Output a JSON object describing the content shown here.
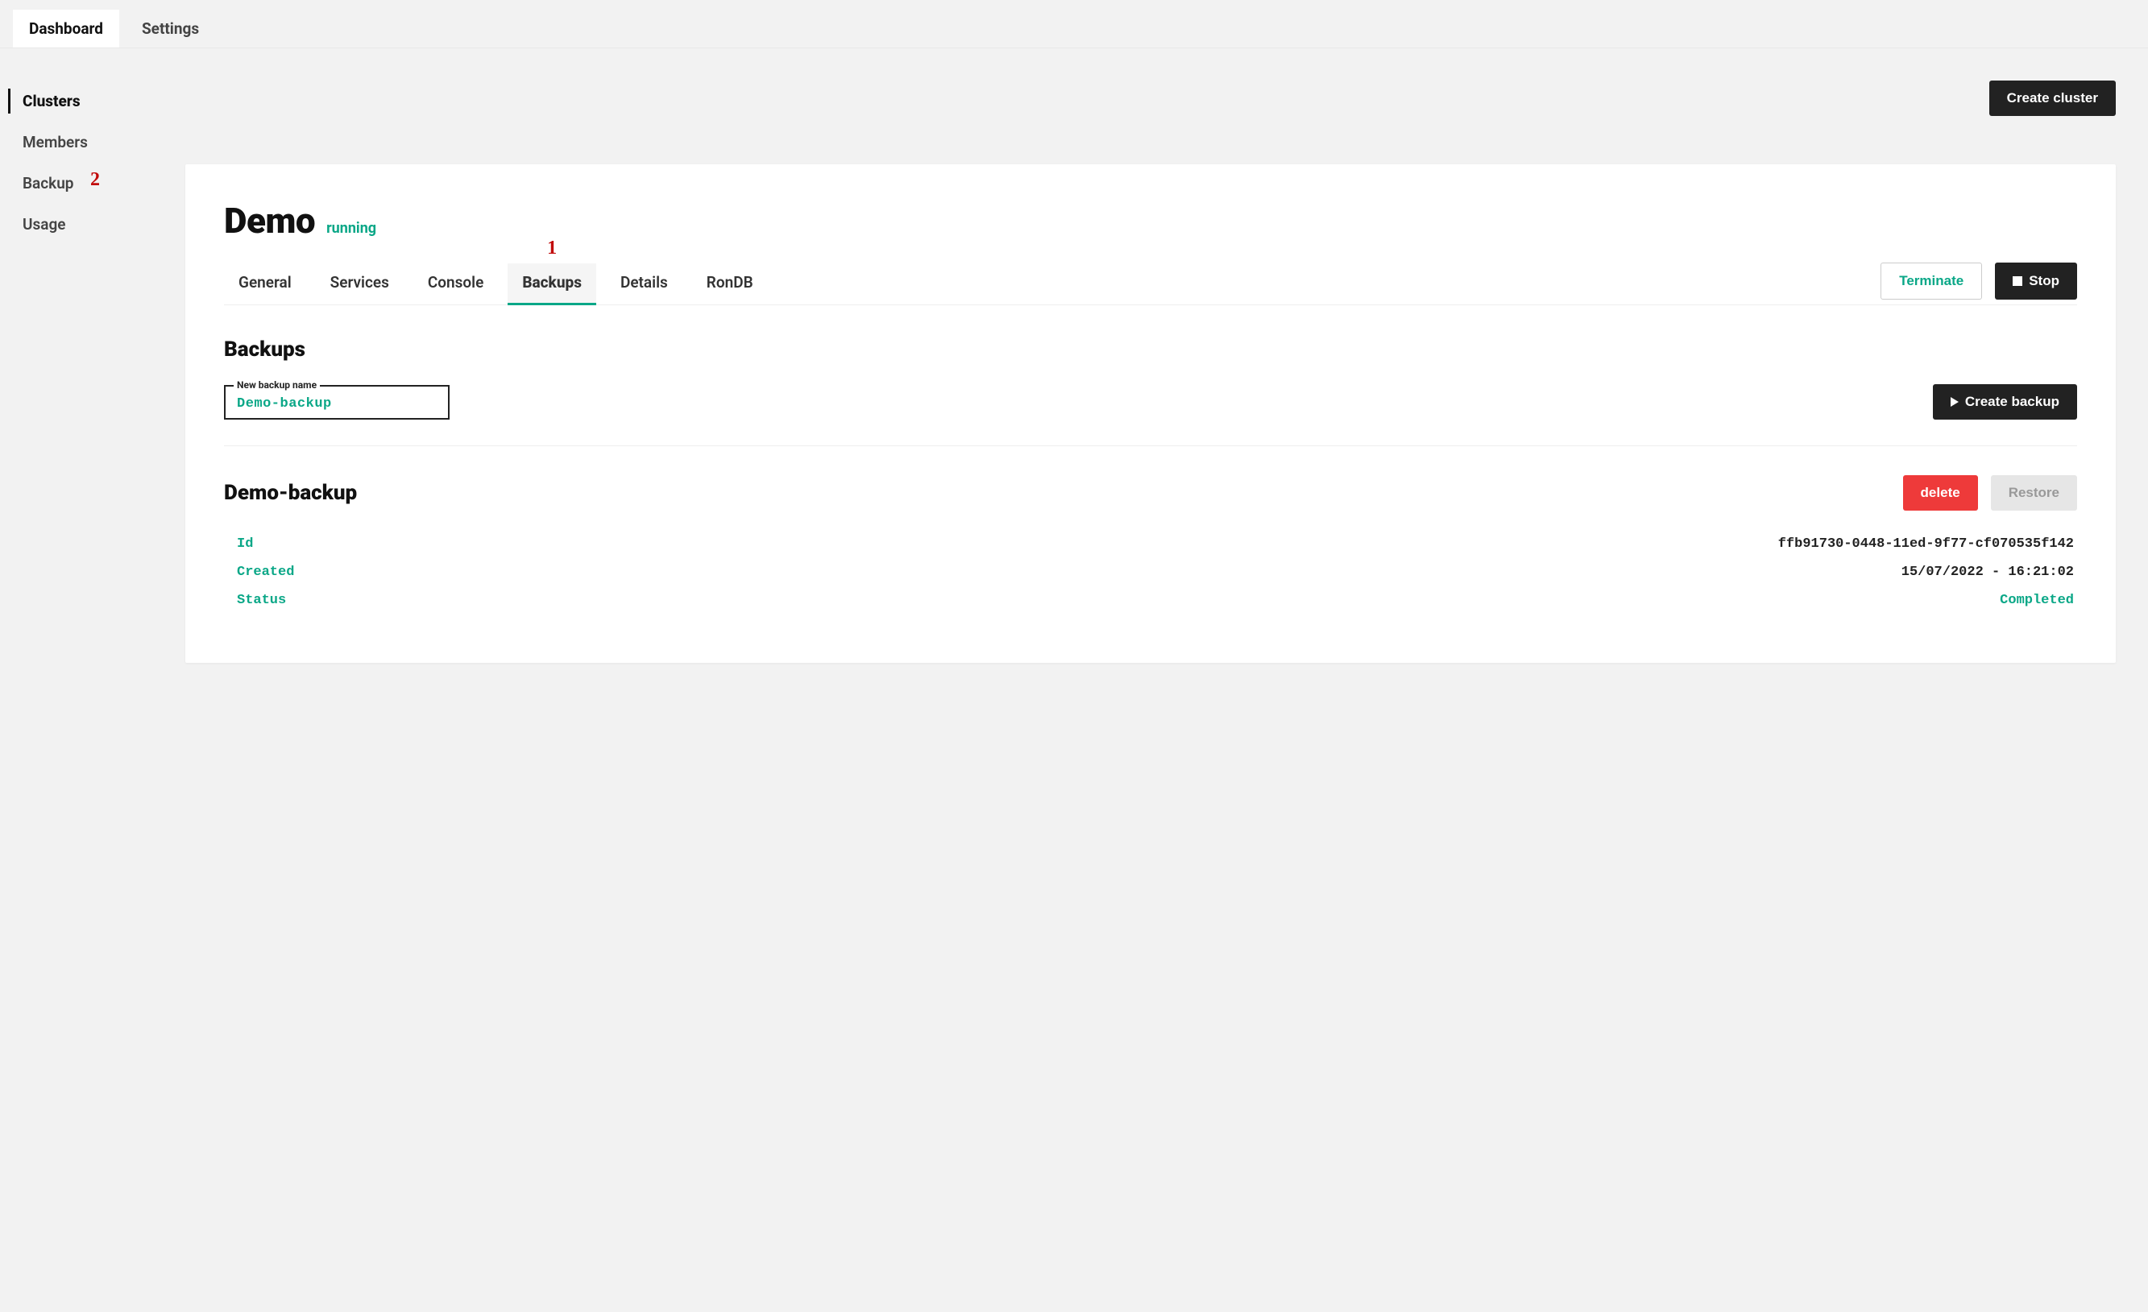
{
  "top_tabs": {
    "dashboard": "Dashboard",
    "settings": "Settings"
  },
  "sidebar": {
    "clusters": "Clusters",
    "members": "Members",
    "backup": "Backup",
    "usage": "Usage"
  },
  "annotations": {
    "a1": "1",
    "a2": "2"
  },
  "toolbar": {
    "create_cluster": "Create cluster"
  },
  "cluster": {
    "name": "Demo",
    "status": "running",
    "tabs": {
      "general": "General",
      "services": "Services",
      "console": "Console",
      "backups": "Backups",
      "details": "Details",
      "rondb": "RonDB"
    },
    "actions": {
      "terminate": "Terminate",
      "stop": "Stop"
    }
  },
  "backups_section": {
    "heading": "Backups",
    "input_label": "New backup name",
    "input_value": "Demo-backup",
    "create_button": "Create backup"
  },
  "backup_item": {
    "title": "Demo-backup",
    "actions": {
      "delete": "delete",
      "restore": "Restore"
    },
    "rows": {
      "id_label": "Id",
      "id_value": "ffb91730-0448-11ed-9f77-cf070535f142",
      "created_label": "Created",
      "created_value": "15/07/2022 - 16:21:02",
      "status_label": "Status",
      "status_value": "Completed"
    }
  }
}
